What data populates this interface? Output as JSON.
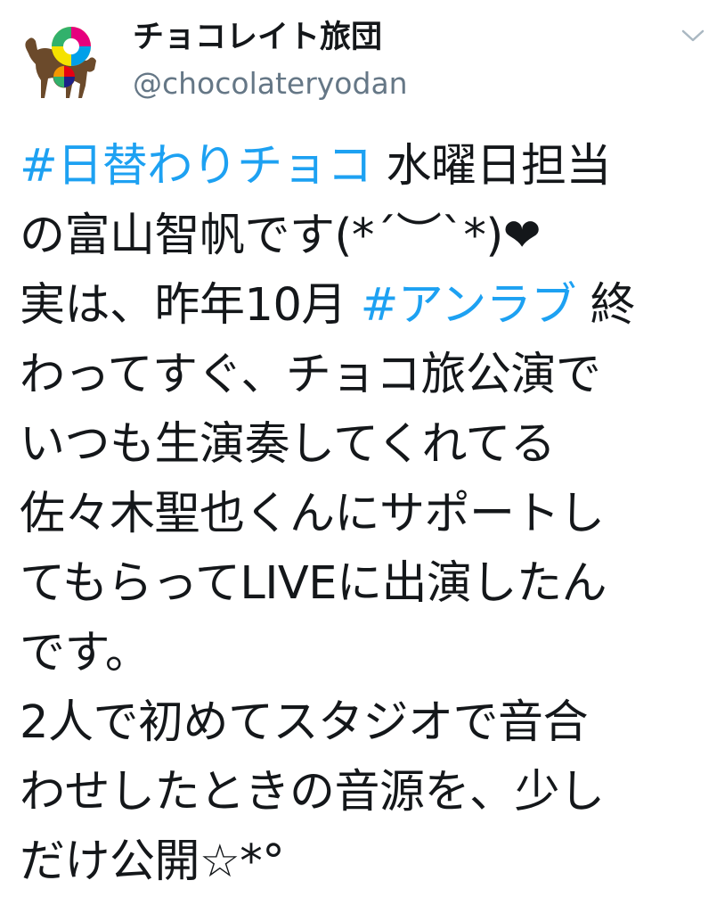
{
  "author": {
    "name": "チョコレイト旅団",
    "handle": "@chocolateryodan"
  },
  "icons": {
    "menu_caret": "chevron-down-icon",
    "avatar": "camel-rainbow-logo"
  },
  "colors": {
    "hashtag": "#1da1f2",
    "text": "#14171a",
    "handle": "#657786",
    "caret": "#aab8c2"
  },
  "tweet": {
    "lines": [
      [
        {
          "text": "#日替わりチョコ",
          "hashtag": true
        },
        {
          "text": " 水曜日担当",
          "hashtag": false
        }
      ],
      [
        {
          "text": "の富山智帆です(*´︶`*)",
          "hashtag": false
        },
        {
          "text": "❤",
          "hashtag": false,
          "heart": true
        }
      ],
      [
        {
          "text": "実は、昨年10月 ",
          "hashtag": false
        },
        {
          "text": "#アンラブ",
          "hashtag": true
        },
        {
          "text": " 終",
          "hashtag": false
        }
      ],
      [
        {
          "text": "わってすぐ、チョコ旅公演で",
          "hashtag": false
        }
      ],
      [
        {
          "text": "いつも生演奏してくれてる",
          "hashtag": false
        }
      ],
      [
        {
          "text": "佐々木聖也くんにサポートし",
          "hashtag": false
        }
      ],
      [
        {
          "text": "てもらってLIVEに出演したん",
          "hashtag": false
        }
      ],
      [
        {
          "text": "です。",
          "hashtag": false
        }
      ],
      [
        {
          "text": "2人で初めてスタジオで音合",
          "hashtag": false
        }
      ],
      [
        {
          "text": "わせしたときの音源を、少し",
          "hashtag": false
        }
      ],
      [
        {
          "text": "だけ公開☆*°",
          "hashtag": false
        }
      ]
    ]
  }
}
